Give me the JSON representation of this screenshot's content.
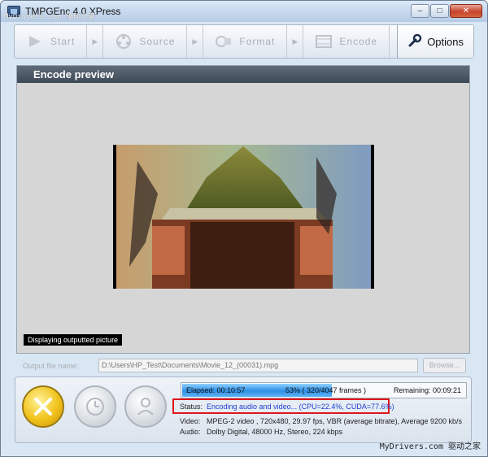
{
  "window": {
    "title": "TMPGEnc 4.0 XPress",
    "watermark_top": "MyDrivers.com 驱动之家",
    "minimize_glyph": "–",
    "maximize_glyph": "□",
    "close_glyph": "✕"
  },
  "toolbar": {
    "start": "Start",
    "source": "Source",
    "format": "Format",
    "encode": "Encode",
    "options": "Options",
    "icons": [
      "play-icon",
      "reel-icon",
      "film-icon",
      "filmstrip-icon",
      "wrench-icon"
    ]
  },
  "panel": {
    "header": "Encode preview",
    "caption": "Displaying outputted picture"
  },
  "output": {
    "label": "Output file name:",
    "value": "D:\\Users\\HP_Test\\Documents\\Movie_12_(00031).mpg",
    "browse": "Browse..."
  },
  "progress": {
    "elapsed": "Elapsed: 00:10:57",
    "frames": "53% ( 320/4047 frames )",
    "remaining": "Remaining: 00:09:21",
    "percent": 53
  },
  "status": {
    "status_label": "Status:",
    "status_value": "Encoding audio and video...    (CPU=22.4%, CUDA=77.6%)",
    "video_label": "Video:",
    "video_value": "MPEG-2 video , 720x480, 29.97 fps, VBR (average bitrate), Average 9200 kb/s",
    "audio_label": "Audio:",
    "audio_value": "Dolby Digital, 48000 Hz, Stereo, 224 kbps"
  },
  "colors": {
    "accent_yellow": "#f1c21b",
    "progress_blue": "#2e90e6",
    "status_highlight": "#e0141c",
    "header_dark": "#3e4957"
  },
  "watermark_bottom": "MyDrivers.com 驱动之家"
}
